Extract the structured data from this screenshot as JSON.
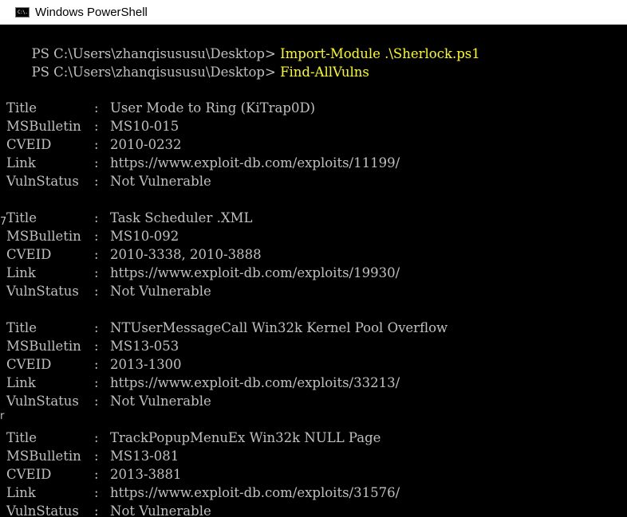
{
  "window": {
    "title": "Windows PowerShell",
    "icon": "powershell-console-icon",
    "icon_text": "C:\\."
  },
  "console": {
    "prompt": "PS C:\\Users\\zhanqisususu\\Desktop> ",
    "commands": [
      "Import-Module .\\Sherlock.ps1",
      "Find-AllVulns"
    ],
    "command_color": "#ffff00",
    "text_color": "#c0c0c0",
    "background": "#000000",
    "labels": {
      "title": "Title",
      "bulletin": "MSBulletin",
      "cveid": "CVEID",
      "link": "Link",
      "status": "VulnStatus",
      "separator": ":"
    },
    "results": [
      {
        "title": "User Mode to Ring (KiTrap0D)",
        "bulletin": "MS10-015",
        "cveid": "2010-0232",
        "link": "https://www.exploit-db.com/exploits/11199/",
        "status": "Not Vulnerable"
      },
      {
        "title": "Task Scheduler .XML",
        "bulletin": "MS10-092",
        "cveid": "2010-3338, 2010-3888",
        "link": "https://www.exploit-db.com/exploits/19930/",
        "status": "Not Vulnerable"
      },
      {
        "title": "NTUserMessageCall Win32k Kernel Pool Overflow",
        "bulletin": "MS13-053",
        "cveid": "2013-1300",
        "link": "https://www.exploit-db.com/exploits/33213/",
        "status": "Not Vulnerable"
      },
      {
        "title": "TrackPopupMenuEx Win32k NULL Page",
        "bulletin": "MS13-081",
        "cveid": "2013-3881",
        "link": "https://www.exploit-db.com/exploits/31576/",
        "status": "Not Vulnerable"
      }
    ],
    "left_edge_glyphs": [
      "7",
      "r"
    ]
  }
}
